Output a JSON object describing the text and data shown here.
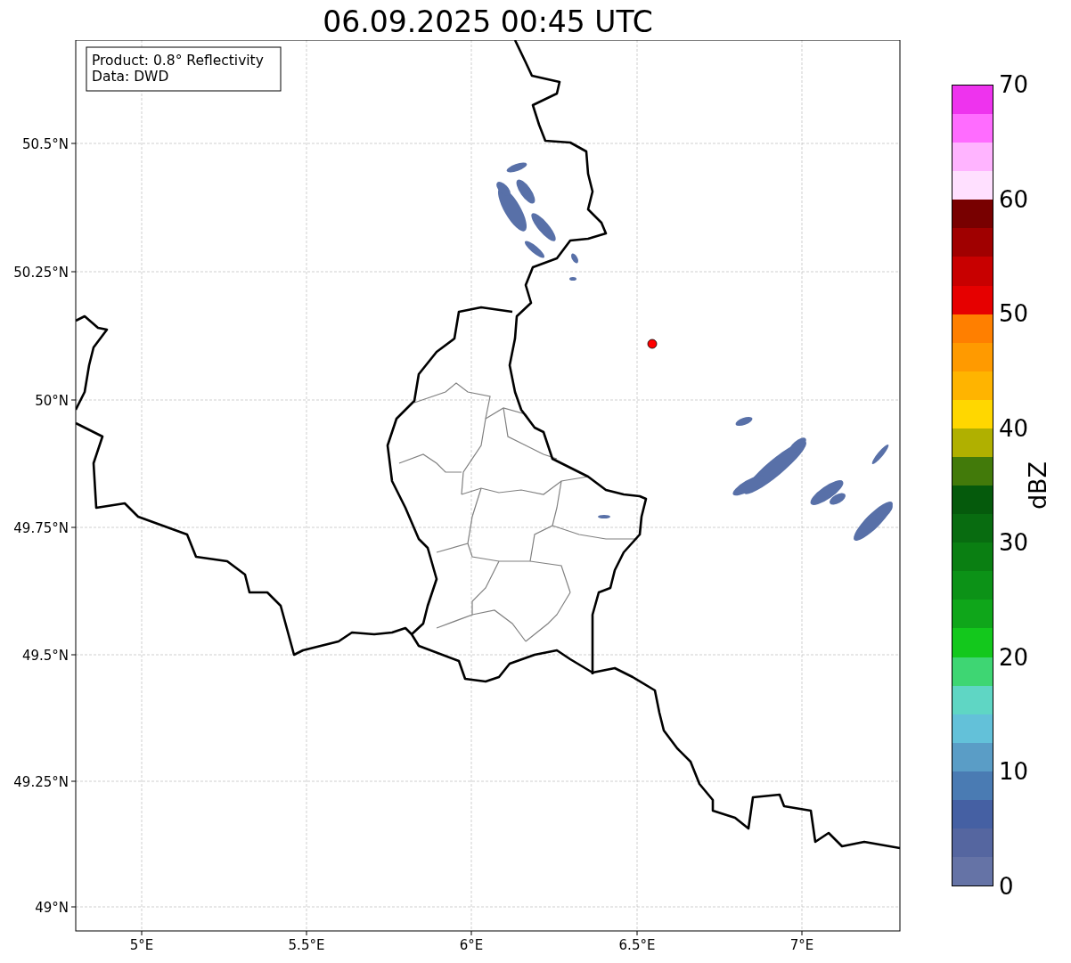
{
  "title": "06.09.2025 00:45 UTC",
  "info_box": [
    "Product: 0.8° Reflectivity",
    "Data: DWD"
  ],
  "map": {
    "lat_labels": [
      "50.5°N",
      "50.25°N",
      "50°N",
      "49.75°N",
      "49.5°N",
      "49.25°N",
      "49°N"
    ],
    "lon_labels": [
      "5°E",
      "5.5°E",
      "6°E",
      "6.5°E",
      "7°E"
    ]
  },
  "colorbar": {
    "label": "dBZ",
    "ticks": [
      "70",
      "60",
      "50",
      "40",
      "30",
      "20",
      "10",
      "0"
    ],
    "segments": [
      {
        "color": "#ee33ee"
      },
      {
        "color": "#ff6cff"
      },
      {
        "color": "#ffb4ff"
      },
      {
        "color": "#ffe0ff"
      },
      {
        "color": "#780000"
      },
      {
        "color": "#a00000"
      },
      {
        "color": "#c80000"
      },
      {
        "color": "#e60000"
      },
      {
        "color": "#ff7f00"
      },
      {
        "color": "#ff9a00"
      },
      {
        "color": "#ffb400"
      },
      {
        "color": "#ffd700"
      },
      {
        "color": "#b0b000"
      },
      {
        "color": "#427a0a"
      },
      {
        "color": "#055a0c"
      },
      {
        "color": "#086c10"
      },
      {
        "color": "#0a7f12"
      },
      {
        "color": "#0c9217"
      },
      {
        "color": "#0fa61a"
      },
      {
        "color": "#13c81c"
      },
      {
        "color": "#3ed673"
      },
      {
        "color": "#5fd6c4"
      },
      {
        "color": "#63c1d9"
      },
      {
        "color": "#5a9dc6"
      },
      {
        "color": "#4a7bb3"
      },
      {
        "color": "#4560a3"
      },
      {
        "color": "#5566a0"
      },
      {
        "color": "#6573a6"
      }
    ]
  }
}
